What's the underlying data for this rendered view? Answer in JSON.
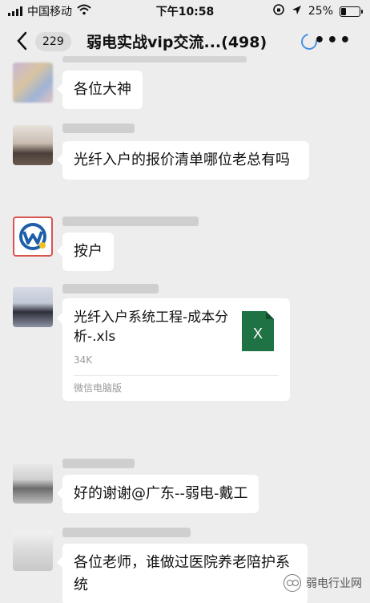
{
  "status_bar": {
    "carrier": "中国移动",
    "time": "下午10:58",
    "battery": "25%",
    "battery_level": 0.25,
    "icons": [
      "signal-icon",
      "wifi-icon",
      "orientation-lock-icon",
      "location-icon",
      "battery-icon"
    ]
  },
  "nav": {
    "back_icon": "chevron-left-icon",
    "unread_count": "229",
    "title": "弱电实战vip交流...(498)",
    "loading_icon": "loading-spinner-icon",
    "more_icon": "more-dots-icon"
  },
  "messages": [
    {
      "type": "text",
      "text": "各位大神"
    },
    {
      "type": "text",
      "text": "光纤入户的报价清单哪位老总有吗"
    },
    {
      "type": "text",
      "text": "按户"
    },
    {
      "type": "file",
      "file_name": "光纤入户系统工程-成本分析-.xls",
      "file_size": "34K",
      "source": "微信电脑版",
      "file_icon": "excel-file-icon",
      "file_icon_letter": "X",
      "file_icon_color": "#1f7244"
    },
    {
      "type": "text",
      "text": "好的谢谢@广东--弱电-戴工"
    },
    {
      "type": "text",
      "text": "各位老师，谁做过医院养老陪护系统"
    }
  ],
  "watermark": {
    "text": "弱电行业网",
    "icon": "wechat-official-account-icon"
  },
  "colors": {
    "background": "#ededed",
    "bubble": "#ffffff",
    "spinner": "#4a90e2"
  }
}
